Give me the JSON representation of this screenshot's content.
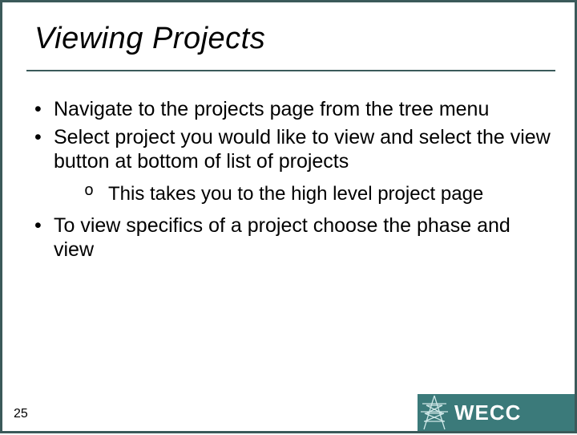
{
  "title": "Viewing Projects",
  "bullets": {
    "b0": "Navigate to the projects page from the tree menu",
    "b1": "Select project you would like to view and select the view button at bottom of list of projects",
    "b1_sub0": "This takes you to the high level project page",
    "b2": "To view specifics of a project choose the phase and view"
  },
  "page_number": "25",
  "logo_text": "WECC"
}
